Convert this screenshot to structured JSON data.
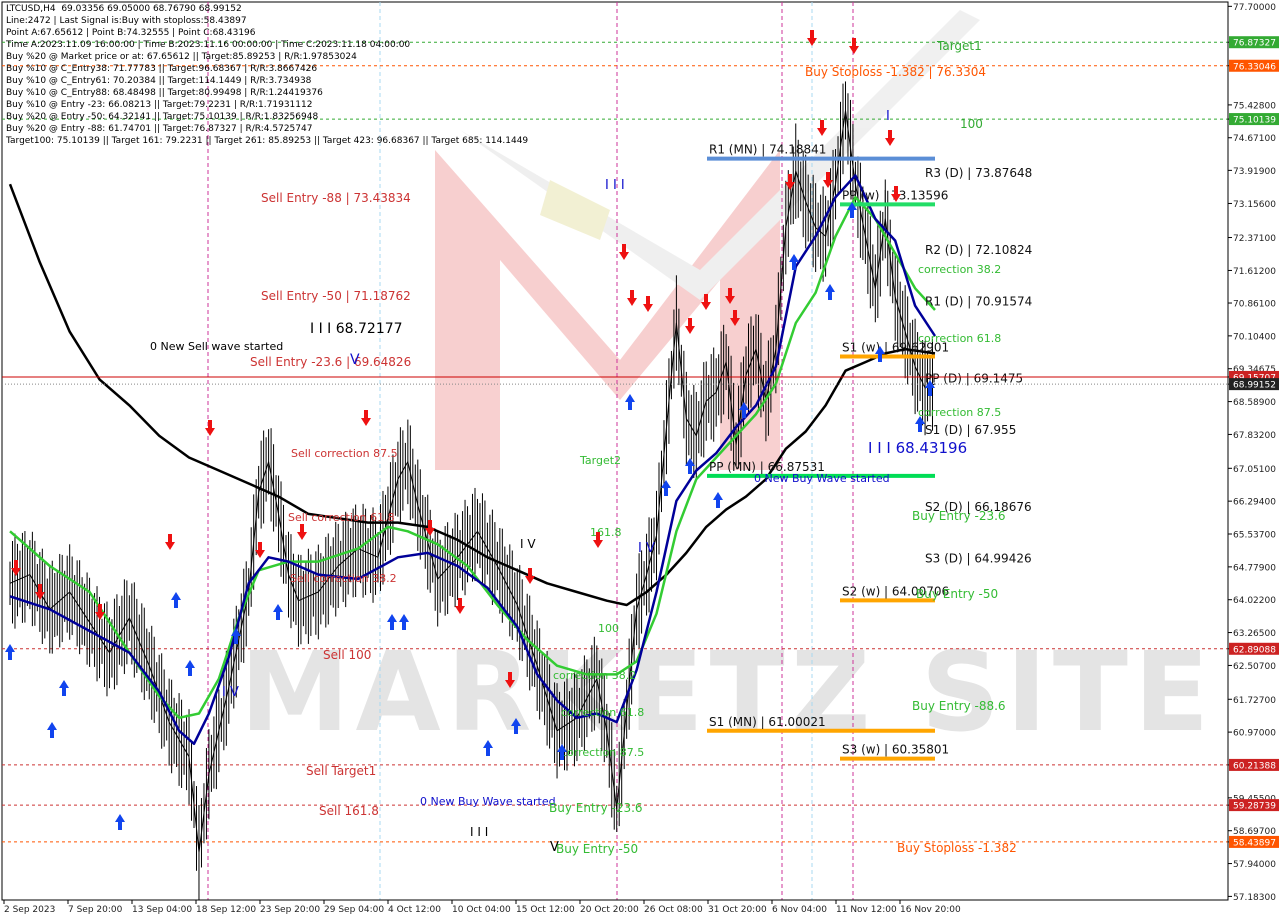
{
  "info": {
    "lines": [
      "LTCUSD,H4  69.03356 69.05000 68.76790 68.99152",
      "Line:2472 | Last Signal is:Buy with stoploss:58.43897",
      "Point A:67.65612 | Point B:74.32555 | Point C:68.43196",
      "Time A:2023.11.09 16:00:00 | Time B:2023.11.16 00:00:00 | Time C:2023.11.18 04:00:00",
      "Buy %20 @ Market price or at: 67.65612 || Target:85.89253 | R/R:1.97853024",
      "Buy %10 @ C_Entry38: 71.77783 || Target:96.68367 | R/R:3.8667426",
      "Buy %10 @ C_Entry61: 70.20384 || Target:114.1449 | R/R:3.734938",
      "Buy %10 @ C_Entry88: 68.48498 || Target:80.99498 | R/R:1.24419376",
      "Buy %10 @ Entry -23: 66.08213 || Target:79.2231 | R/R:1.71931112",
      "Buy %20 @ Entry -50: 64.32141 || Target:75.10139 | R/R:1.83256948",
      "Buy %20 @ Entry -88: 61.74701 || Target:76.87327 | R/R:4.5725747",
      "Target100: 75.10139 || Target 161: 79.2231 || Target 261: 85.89253 || Target 423: 96.68367 || Target 685: 114.1449"
    ]
  },
  "chart_data": {
    "type": "line",
    "symbol": "LTCUSD,H4",
    "ylim": [
      57.1,
      77.8
    ],
    "y_ticks": [
      "77.70000",
      "76.87327",
      "76.33046",
      "75.42800",
      "75.10139",
      "74.67100",
      "73.91900",
      "73.15600",
      "72.37100",
      "71.61200",
      "70.86100",
      "70.10400",
      "69.34675",
      "69.15707",
      "68.99152",
      "68.58900",
      "67.83200",
      "67.05100",
      "66.29400",
      "65.53700",
      "64.77900",
      "64.02200",
      "63.26500",
      "62.89088",
      "62.50700",
      "61.72700",
      "60.97000",
      "60.21388",
      "59.45500",
      "59.28739",
      "58.69700",
      "58.43897",
      "57.94000",
      "57.18300"
    ],
    "y_tick_values": [
      77.7,
      76.87327,
      76.33046,
      75.428,
      75.10139,
      74.671,
      73.919,
      73.156,
      72.371,
      71.612,
      70.861,
      70.104,
      69.34675,
      69.15707,
      68.99152,
      68.589,
      67.832,
      67.051,
      66.294,
      65.537,
      64.779,
      64.022,
      63.265,
      62.89088,
      62.507,
      61.727,
      60.97,
      60.21388,
      59.455,
      59.28739,
      58.697,
      58.43897,
      57.94,
      57.183
    ],
    "y_tick_styles": [
      "",
      "green",
      "orange",
      "",
      "green",
      "",
      "",
      "",
      "",
      "",
      "",
      "",
      "",
      "red",
      "dark",
      "",
      "",
      "",
      "",
      "",
      "",
      "",
      "",
      "red",
      "",
      "",
      "",
      "red",
      "",
      "red",
      "",
      "orange",
      "",
      ""
    ],
    "x_labels": [
      "2 Sep 2023",
      "7 Sep 20:00",
      "13 Sep 04:00",
      "18 Sep 12:00",
      "23 Sep 20:00",
      "29 Sep 04:00",
      "4 Oct 12:00",
      "10 Oct 04:00",
      "15 Oct 12:00",
      "20 Oct 20:00",
      "26 Oct 08:00",
      "31 Oct 20:00",
      "6 Nov 04:00",
      "11 Nov 12:00",
      "16 Nov 20:00"
    ],
    "price_points": [
      [
        0,
        64.4
      ],
      [
        4,
        64.6
      ],
      [
        8,
        63.8
      ],
      [
        12,
        64.2
      ],
      [
        16,
        63.5
      ],
      [
        20,
        62.8
      ],
      [
        24,
        63.6
      ],
      [
        28,
        62.5
      ],
      [
        32,
        61.2
      ],
      [
        36,
        60.4
      ],
      [
        38,
        58.2
      ],
      [
        40,
        60.0
      ],
      [
        44,
        62.0
      ],
      [
        48,
        64.2
      ],
      [
        50,
        66.5
      ],
      [
        52,
        67.2
      ],
      [
        54,
        66.0
      ],
      [
        56,
        64.6
      ],
      [
        58,
        64.0
      ],
      [
        62,
        64.2
      ],
      [
        66,
        64.8
      ],
      [
        70,
        65.2
      ],
      [
        74,
        65.0
      ],
      [
        78,
        66.8
      ],
      [
        80,
        67.2
      ],
      [
        82,
        66.2
      ],
      [
        86,
        64.5
      ],
      [
        90,
        65.0
      ],
      [
        94,
        65.6
      ],
      [
        98,
        64.8
      ],
      [
        102,
        63.9
      ],
      [
        106,
        62.5
      ],
      [
        110,
        61.0
      ],
      [
        114,
        61.3
      ],
      [
        118,
        62.2
      ],
      [
        120,
        61.0
      ],
      [
        122,
        59.2
      ],
      [
        124,
        61.5
      ],
      [
        126,
        63.8
      ],
      [
        128,
        64.6
      ],
      [
        130,
        65.5
      ],
      [
        132,
        68.0
      ],
      [
        134,
        70.4
      ],
      [
        136,
        68.2
      ],
      [
        138,
        67.8
      ],
      [
        140,
        68.6
      ],
      [
        142,
        68.8
      ],
      [
        144,
        69.5
      ],
      [
        146,
        67.6
      ],
      [
        148,
        69.2
      ],
      [
        150,
        69.8
      ],
      [
        152,
        68.6
      ],
      [
        154,
        69.8
      ],
      [
        156,
        72.6
      ],
      [
        158,
        73.9
      ],
      [
        160,
        73.2
      ],
      [
        162,
        72.6
      ],
      [
        164,
        72.4
      ],
      [
        166,
        73.6
      ],
      [
        168,
        75.3
      ],
      [
        170,
        73.6
      ],
      [
        172,
        72.4
      ],
      [
        174,
        71.2
      ],
      [
        176,
        72.8
      ],
      [
        178,
        71.0
      ],
      [
        180,
        70.2
      ],
      [
        182,
        69.4
      ],
      [
        184,
        68.9
      ],
      [
        186,
        69.0
      ]
    ],
    "ma_blue": [
      [
        0,
        64.1
      ],
      [
        8,
        63.8
      ],
      [
        16,
        63.3
      ],
      [
        24,
        62.8
      ],
      [
        30,
        61.9
      ],
      [
        34,
        61.0
      ],
      [
        37,
        60.7
      ],
      [
        40,
        61.4
      ],
      [
        44,
        62.7
      ],
      [
        48,
        64.4
      ],
      [
        52,
        65.0
      ],
      [
        56,
        64.9
      ],
      [
        62,
        64.6
      ],
      [
        70,
        64.5
      ],
      [
        78,
        65.0
      ],
      [
        84,
        65.1
      ],
      [
        90,
        64.8
      ],
      [
        96,
        64.3
      ],
      [
        102,
        63.4
      ],
      [
        106,
        62.3
      ],
      [
        110,
        61.7
      ],
      [
        114,
        61.3
      ],
      [
        118,
        61.4
      ],
      [
        122,
        61.2
      ],
      [
        126,
        62.4
      ],
      [
        130,
        64.2
      ],
      [
        134,
        66.3
      ],
      [
        138,
        67.0
      ],
      [
        142,
        67.4
      ],
      [
        146,
        68.0
      ],
      [
        150,
        68.5
      ],
      [
        154,
        69.4
      ],
      [
        158,
        71.7
      ],
      [
        162,
        72.4
      ],
      [
        166,
        73.3
      ],
      [
        170,
        73.8
      ],
      [
        174,
        72.8
      ],
      [
        178,
        72.3
      ],
      [
        182,
        70.8
      ],
      [
        186,
        70.1
      ]
    ],
    "ma_green": [
      [
        0,
        65.6
      ],
      [
        8,
        64.8
      ],
      [
        16,
        64.2
      ],
      [
        24,
        62.8
      ],
      [
        30,
        61.8
      ],
      [
        34,
        61.3
      ],
      [
        38,
        61.4
      ],
      [
        42,
        62.2
      ],
      [
        46,
        63.6
      ],
      [
        50,
        64.7
      ],
      [
        56,
        64.9
      ],
      [
        62,
        64.9
      ],
      [
        70,
        65.2
      ],
      [
        76,
        65.7
      ],
      [
        80,
        65.6
      ],
      [
        86,
        65.3
      ],
      [
        92,
        64.8
      ],
      [
        98,
        63.9
      ],
      [
        104,
        63.1
      ],
      [
        110,
        62.5
      ],
      [
        116,
        62.3
      ],
      [
        122,
        62.3
      ],
      [
        126,
        62.6
      ],
      [
        130,
        63.7
      ],
      [
        134,
        65.6
      ],
      [
        138,
        66.8
      ],
      [
        142,
        67.3
      ],
      [
        146,
        67.8
      ],
      [
        150,
        68.3
      ],
      [
        154,
        69.0
      ],
      [
        158,
        70.4
      ],
      [
        162,
        71.1
      ],
      [
        166,
        72.4
      ],
      [
        170,
        73.3
      ],
      [
        174,
        72.8
      ],
      [
        178,
        72.0
      ],
      [
        182,
        71.2
      ],
      [
        186,
        70.7
      ]
    ],
    "ma_black": [
      [
        0,
        73.6
      ],
      [
        6,
        71.8
      ],
      [
        12,
        70.2
      ],
      [
        18,
        69.1
      ],
      [
        24,
        68.5
      ],
      [
        30,
        67.8
      ],
      [
        36,
        67.3
      ],
      [
        42,
        67.0
      ],
      [
        48,
        66.7
      ],
      [
        54,
        66.4
      ],
      [
        60,
        66.0
      ],
      [
        66,
        65.9
      ],
      [
        72,
        65.8
      ],
      [
        78,
        65.8
      ],
      [
        84,
        65.7
      ],
      [
        90,
        65.4
      ],
      [
        96,
        65.0
      ],
      [
        102,
        64.7
      ],
      [
        108,
        64.4
      ],
      [
        114,
        64.2
      ],
      [
        120,
        64.0
      ],
      [
        124,
        63.9
      ],
      [
        128,
        64.2
      ],
      [
        132,
        64.6
      ],
      [
        136,
        65.1
      ],
      [
        140,
        65.7
      ],
      [
        144,
        66.1
      ],
      [
        148,
        66.4
      ],
      [
        152,
        66.8
      ],
      [
        156,
        67.5
      ],
      [
        160,
        67.9
      ],
      [
        164,
        68.5
      ],
      [
        168,
        69.3
      ],
      [
        172,
        69.5
      ],
      [
        176,
        69.7
      ],
      [
        180,
        69.8
      ],
      [
        186,
        69.7
      ]
    ],
    "current_price": 68.99152,
    "red_line_price": 69.15707,
    "pivots": [
      {
        "label": "R1 (MN) | 74.18841",
        "value": 74.18841,
        "color": "#5b8ed6"
      },
      {
        "label": "PP (MN) | 66.87531",
        "value": 66.87531,
        "color": "#00dd55"
      },
      {
        "label": "S1 (MN) | 61.00021",
        "value": 61.00021,
        "color": "#ffa500"
      },
      {
        "label": "PP (w) | 73.13596",
        "value": 73.13596,
        "color": "#22dd66"
      },
      {
        "label": "S1 (w) | 69.62901",
        "value": 69.62901,
        "color": "#ffa500"
      },
      {
        "label": "S2 (w) | 64.00706",
        "value": 64.00706,
        "color": "#ffa500"
      },
      {
        "label": "S3 (w) | 60.35801",
        "value": 60.35801,
        "color": "#ffa500"
      }
    ],
    "daily_labels": [
      {
        "label": "R3 (D) | 73.87648",
        "value": 73.87648
      },
      {
        "label": "R2 (D) | 72.10824",
        "value": 72.10824
      },
      {
        "label": "R1 (D) | 70.91574",
        "value": 70.91574
      },
      {
        "label": "PP (D) | 69.1475",
        "value": 69.1475
      },
      {
        "label": "S1 (D) | 67.955",
        "value": 67.955
      },
      {
        "label": "S2 (D) | 66.18676",
        "value": 66.18676
      },
      {
        "label": "S3 (D) | 64.99426",
        "value": 64.99426
      }
    ],
    "dashed_levels": [
      {
        "value": 76.87327,
        "color": "#33aa33",
        "label": "Target1"
      },
      {
        "value": 76.33046,
        "color": "#ff5500",
        "label": "Buy Stoploss -1.382 | 76.3304"
      },
      {
        "value": 75.10139,
        "color": "#33aa33",
        "label": "100"
      },
      {
        "value": 62.89088,
        "color": "#cc3333",
        "label": "Sell 100"
      },
      {
        "value": 60.21388,
        "color": "#cc3333",
        "label": "Sell Target1"
      },
      {
        "value": 59.28739,
        "color": "#cc3333",
        "label": "Sell 161.8"
      },
      {
        "value": 58.43897,
        "color": "#ff5500",
        "label": "Buy Stoploss -1.382"
      }
    ],
    "annotations": [
      {
        "text": "Sell Entry -88 | 73.43834",
        "color": "#cc3333",
        "size": 12
      },
      {
        "text": "Sell Entry -50 | 71.18762",
        "color": "#cc3333",
        "size": 12
      },
      {
        "text": "Sell Entry -23.6 | 69.64826",
        "color": "#cc3333",
        "size": 12
      },
      {
        "text": "I I I 68.72177",
        "color": "#000000",
        "size": 14
      },
      {
        "text": "0 New Sell wave started",
        "color": "#000000",
        "size": 11
      },
      {
        "text": "Sell correction 87.5",
        "color": "#cc3333",
        "size": 11
      },
      {
        "text": "Sell correction 61.8",
        "color": "#cc3333",
        "size": 11
      },
      {
        "text": "Sell correction 38.2",
        "color": "#cc3333",
        "size": 11
      },
      {
        "text": "0 New Buy Wave started",
        "color": "#1010cc",
        "size": 11
      },
      {
        "text": "Buy Entry -23.6",
        "color": "#33bb33",
        "size": 12
      },
      {
        "text": "Buy Entry -50",
        "color": "#33bb33",
        "size": 12
      },
      {
        "text": "correction 38.2",
        "color": "#33bb33",
        "size": 11
      },
      {
        "text": "correction 61.8",
        "color": "#33bb33",
        "size": 11
      },
      {
        "text": "correction 87.5",
        "color": "#33bb33",
        "size": 11
      },
      {
        "text": "Target2",
        "color": "#33bb33",
        "size": 11
      },
      {
        "text": "161.8",
        "color": "#33bb33",
        "size": 11
      },
      {
        "text": "100",
        "color": "#33bb33",
        "size": 11
      },
      {
        "text": "I V",
        "color": "#1010cc",
        "size": 13
      },
      {
        "text": "I I I",
        "color": "#1010cc",
        "size": 13
      },
      {
        "text": "V",
        "color": "#1010cc",
        "size": 14
      },
      {
        "text": "0 New Buy Wave started",
        "color": "#1010cc",
        "size": 11
      },
      {
        "text": "I I I 68.43196",
        "color": "#1010cc",
        "size": 15
      },
      {
        "text": "Buy Entry -23.6",
        "color": "#33bb33",
        "size": 12
      },
      {
        "text": "Buy Entry -50",
        "color": "#33bb33",
        "size": 12
      },
      {
        "text": "Buy Entry -88.6",
        "color": "#33bb33",
        "size": 12
      },
      {
        "text": "correction 38.2",
        "color": "#33bb33",
        "size": 11
      },
      {
        "text": "correction 61.8",
        "color": "#33bb33",
        "size": 11
      },
      {
        "text": "correction 87.5",
        "color": "#33bb33",
        "size": 11
      },
      {
        "text": "I V",
        "color": "#1010cc",
        "size": 13
      },
      {
        "text": "I V",
        "color": "#000000",
        "size": 12
      },
      {
        "text": "I I I",
        "color": "#000000",
        "size": 12
      },
      {
        "text": "V",
        "color": "#000000",
        "size": 13
      },
      {
        "text": "I",
        "color": "#1010cc",
        "size": 13
      }
    ],
    "colors": {
      "price": "#000000",
      "ma_blue": "#000099",
      "ma_green": "#33cc33",
      "ma_black": "#000000",
      "current": "#cc0000",
      "watermark": "#d9d9d9"
    },
    "watermark": "MARKETZ SITE"
  }
}
